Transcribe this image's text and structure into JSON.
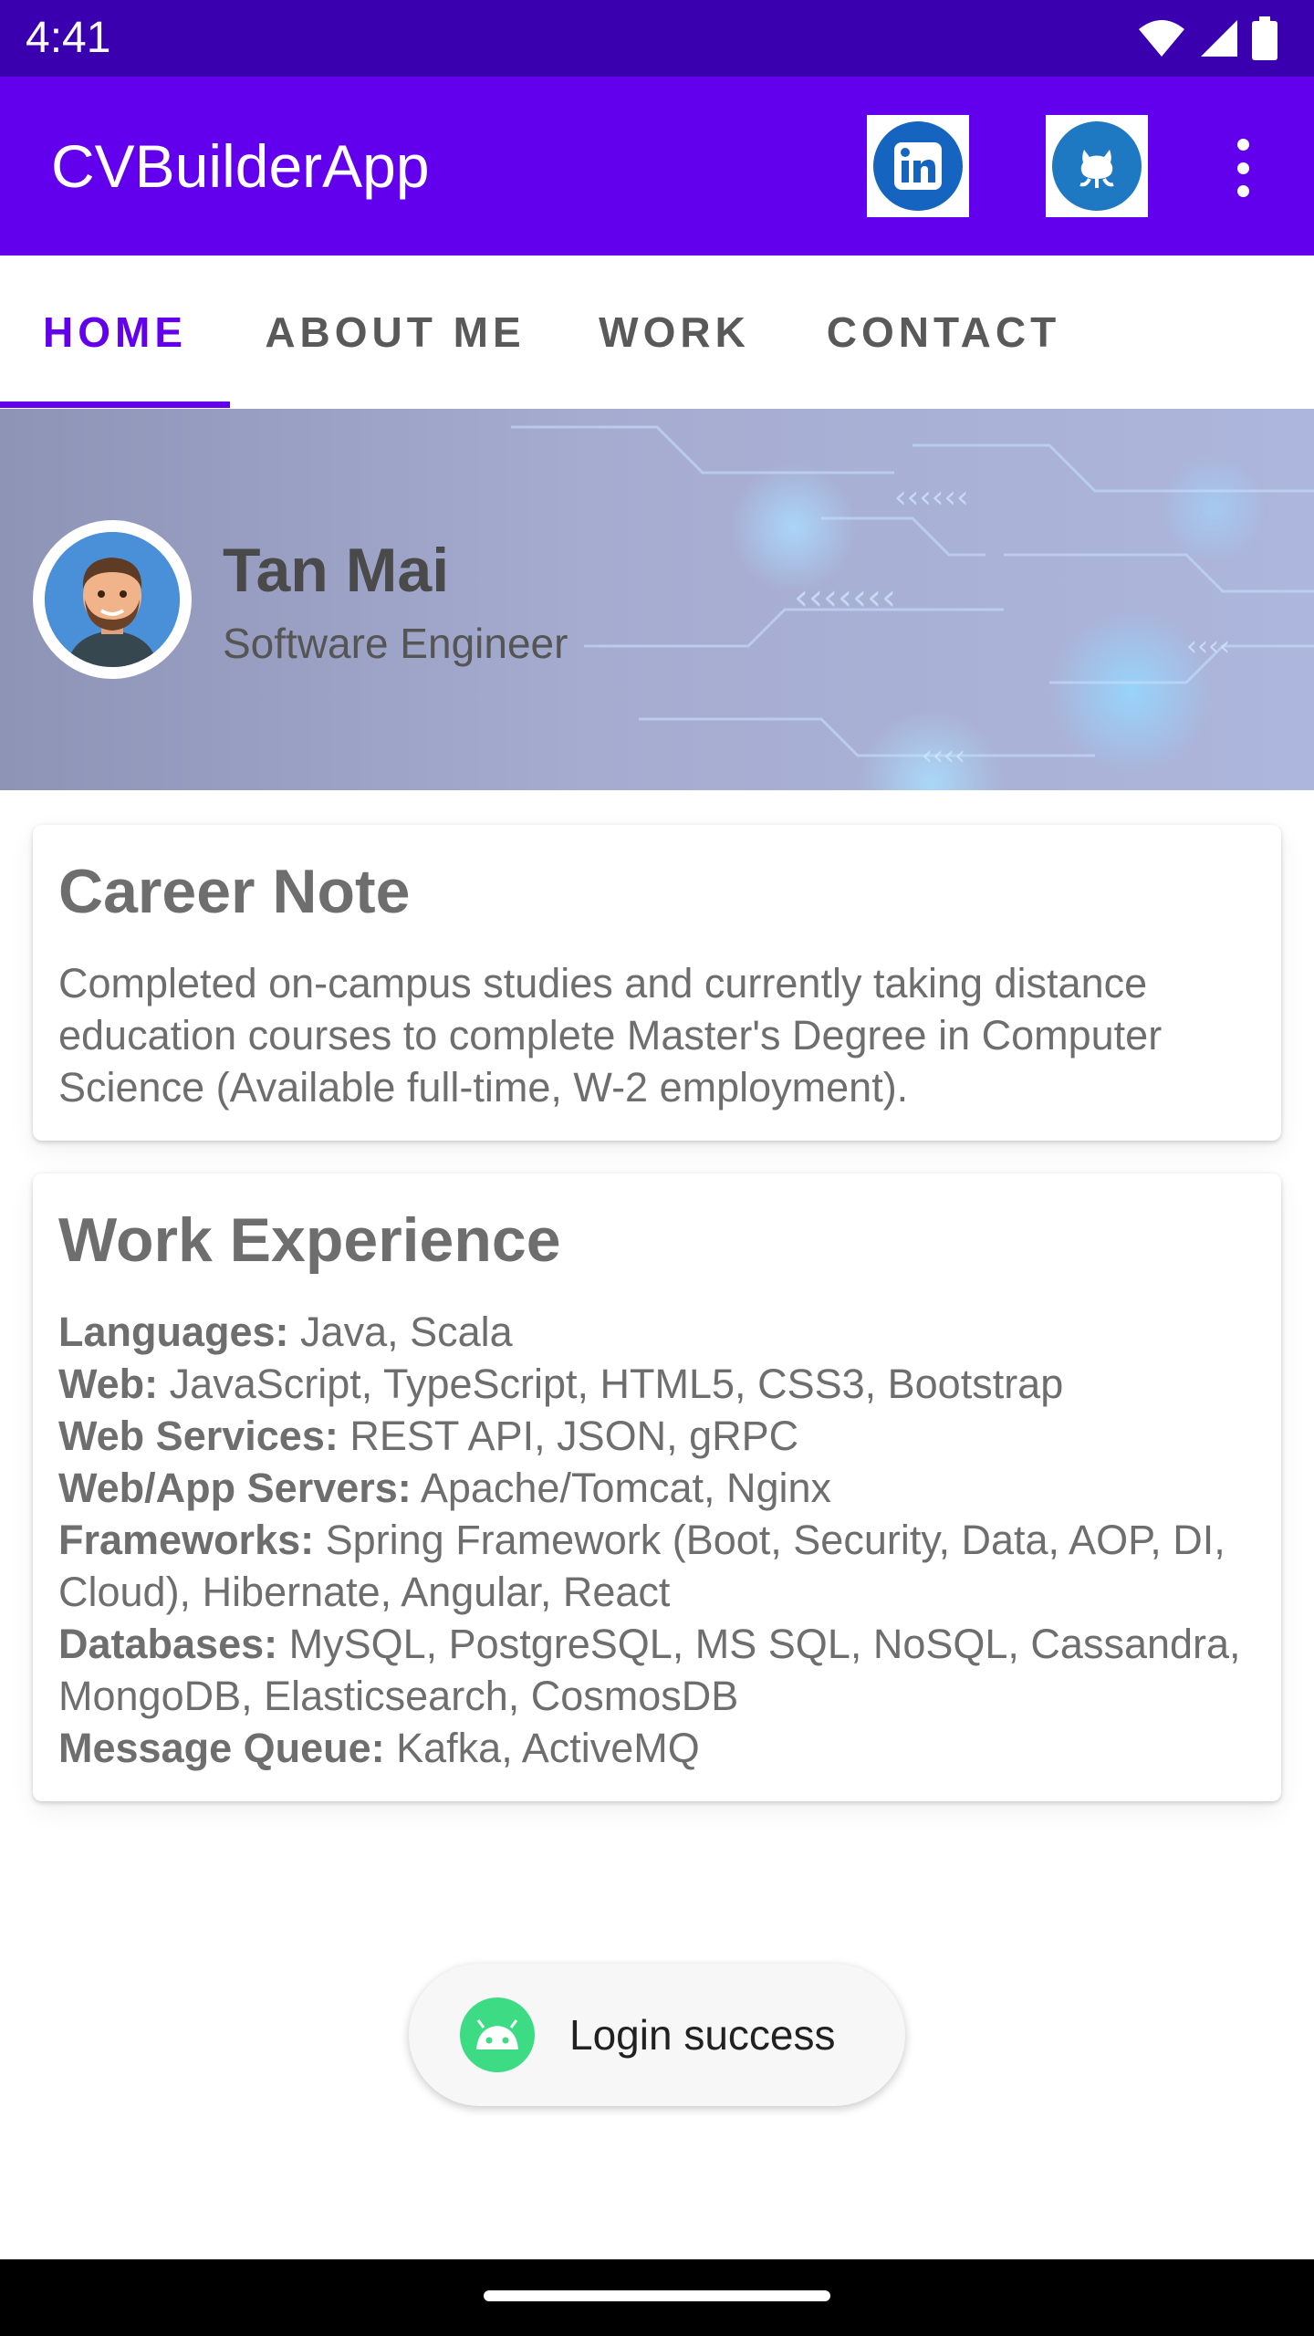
{
  "status_bar": {
    "time": "4:41",
    "icons": [
      "wifi-icon",
      "signal-icon",
      "battery-icon"
    ]
  },
  "app_bar": {
    "title": "CVBuilderApp",
    "actions": [
      "linkedin-icon",
      "github-icon",
      "more-vert-icon"
    ],
    "colors": {
      "primary": "#6200ee",
      "primary_dark": "#3a00b0"
    }
  },
  "tabs": [
    {
      "label": "HOME",
      "active": true
    },
    {
      "label": "ABOUT ME",
      "active": false
    },
    {
      "label": "WORK",
      "active": false
    },
    {
      "label": "CONTACT",
      "active": false
    }
  ],
  "profile": {
    "name": "Tan Mai",
    "role": "Software Engineer"
  },
  "career_note": {
    "title": "Career Note",
    "text": "Completed on-campus studies and currently taking distance education courses to complete Master's Degree in Computer Science (Available full-time, W-2 employment)."
  },
  "work_experience": {
    "title": "Work Experience",
    "skills": [
      {
        "label": "Languages:",
        "value": " Java, Scala"
      },
      {
        "label": "Web:",
        "value": " JavaScript, TypeScript, HTML5, CSS3, Bootstrap"
      },
      {
        "label": "Web Services:",
        "value": " REST API, JSON, gRPC"
      },
      {
        "label": "Web/App Servers:",
        "value": " Apache/Tomcat, Nginx"
      },
      {
        "label": "Frameworks:",
        "value": " Spring Framework (Boot, Security, Data, AOP, DI, Cloud), Hibernate, Angular, React"
      },
      {
        "label": "Databases:",
        "value": " MySQL, PostgreSQL, MS SQL, NoSQL, Cassandra, MongoDB, Elasticsearch, CosmosDB"
      },
      {
        "label": "Message Queue:",
        "value": " Kafka, ActiveMQ"
      }
    ]
  },
  "toast": {
    "text": "Login success",
    "icon": "android-icon"
  }
}
